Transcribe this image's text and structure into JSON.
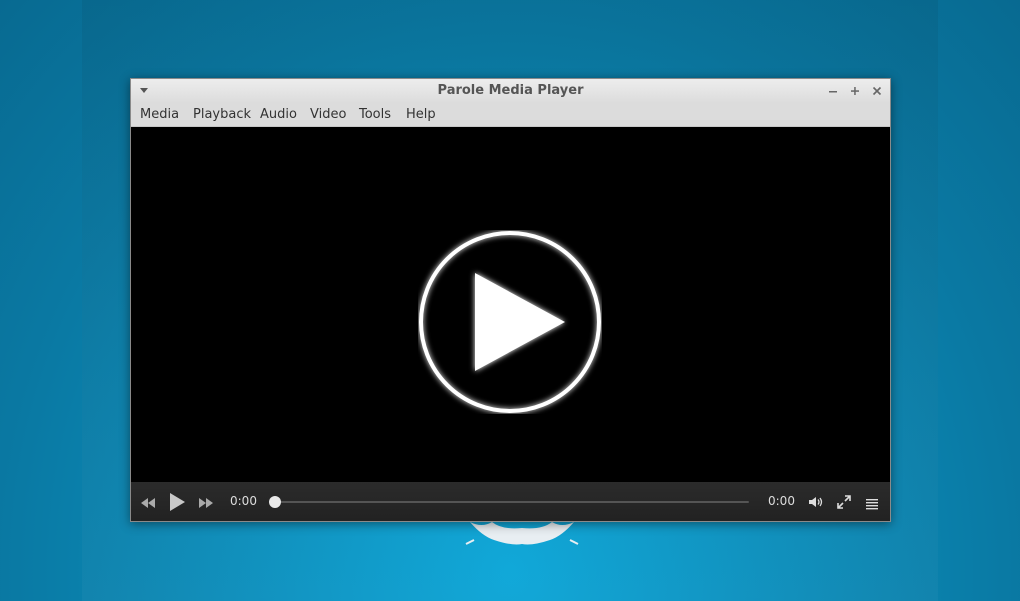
{
  "window": {
    "title": "Parole Media Player"
  },
  "menubar": {
    "items": [
      {
        "label": "Media"
      },
      {
        "label": "Playback"
      },
      {
        "label": "Audio"
      },
      {
        "label": "Video"
      },
      {
        "label": "Tools"
      },
      {
        "label": "Help"
      }
    ]
  },
  "controls": {
    "position_time": "0:00",
    "duration_time": "0:00",
    "seek_fraction": 0
  },
  "icons": {
    "window_menu": "chevron-down-icon",
    "minimize": "minimize-icon",
    "maximize": "maximize-icon",
    "close": "close-icon",
    "previous": "rewind-icon",
    "play": "play-icon",
    "next": "fast-forward-icon",
    "volume": "volume-icon",
    "fullscreen": "fullscreen-icon",
    "playlist": "playlist-icon"
  },
  "colors": {
    "desktop": "#0a8fbd",
    "titlebar": "#dcdcdc",
    "video": "#000000",
    "controls": "#262626"
  }
}
